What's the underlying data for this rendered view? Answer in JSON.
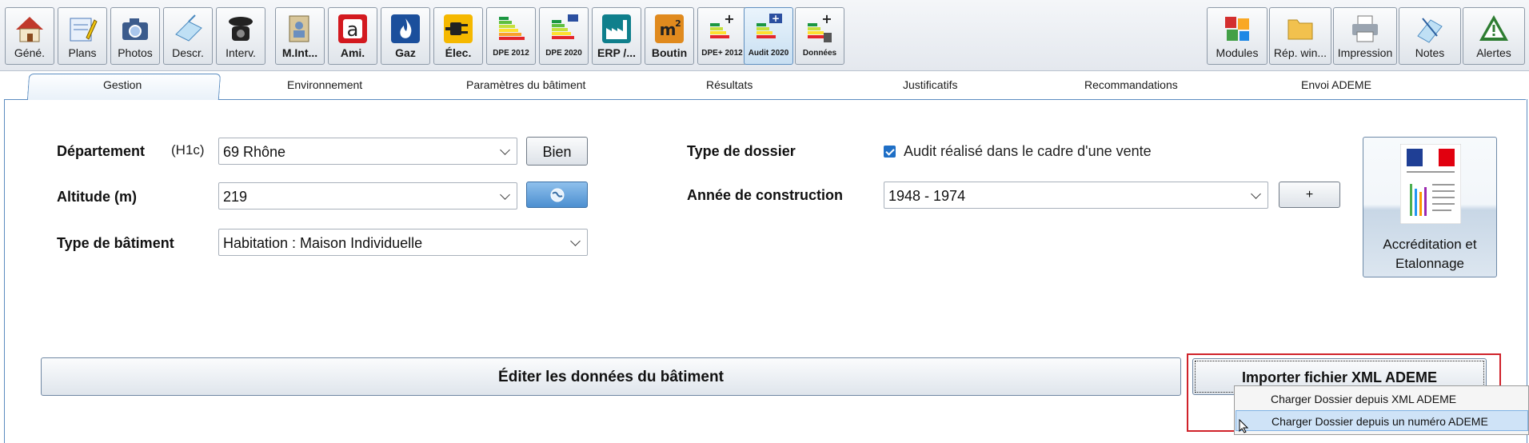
{
  "toolbar": {
    "left_buttons": [
      {
        "label": "Géné.",
        "icon": "house-icon"
      },
      {
        "label": "Plans",
        "icon": "plans-pencil-icon"
      },
      {
        "label": "Photos",
        "icon": "camera-icon"
      },
      {
        "label": "Descr.",
        "icon": "description-icon"
      },
      {
        "label": "Interv.",
        "icon": "phone-icon"
      },
      {
        "label": "M.Int...",
        "icon": "document-person-icon"
      },
      {
        "label": "Ami.",
        "icon": "asbestos-a-icon"
      },
      {
        "label": "Gaz",
        "icon": "gas-flame-icon"
      },
      {
        "label": "Élec.",
        "icon": "electric-plug-icon"
      },
      {
        "label": "DPE 2012",
        "icon": "energy-label-icon"
      },
      {
        "label": "DPE 2020",
        "icon": "energy-label-eu-icon"
      },
      {
        "label": "ERP /...",
        "icon": "factory-icon"
      },
      {
        "label": "Boutin",
        "icon": "m2-surface-icon"
      },
      {
        "label": "DPE+ 2012",
        "icon": "energy-label-plus-icon"
      },
      {
        "label": "Audit 2020",
        "icon": "energy-label-plus-active-icon"
      },
      {
        "label": "Données",
        "icon": "energy-label-data-icon"
      }
    ],
    "right_buttons": [
      {
        "label": "Modules",
        "icon": "puzzle-icon"
      },
      {
        "label": "Rép. win...",
        "icon": "folder-icon"
      },
      {
        "label": "Impression",
        "icon": "printer-icon"
      },
      {
        "label": "Notes",
        "icon": "notes-icon"
      },
      {
        "label": "Alertes",
        "icon": "alert-triangle-icon"
      }
    ]
  },
  "tabs": [
    "Gestion",
    "Environnement",
    "Paramètres du bâtiment",
    "Résultats",
    "Justificatifs",
    "Recommandations",
    "Envoi ADEME"
  ],
  "form": {
    "departement_label": "Département",
    "departement_zone": "(H1c)",
    "departement_value": "69  Rhône",
    "bien_button": "Bien",
    "altitude_label": "Altitude (m)",
    "altitude_value": "219",
    "type_batiment_label": "Type de bâtiment",
    "type_batiment_value": "Habitation : Maison Individuelle",
    "type_dossier_label": "Type de dossier",
    "type_dossier_checkbox": "Audit réalisé dans le cadre d'une vente",
    "annee_label": "Année de construction",
    "annee_value": "1948 - 1974",
    "plus_button": "+",
    "accreditation_line1": "Accréditation et",
    "accreditation_line2": "Etalonnage"
  },
  "actions": {
    "edit_button": "Éditer les données du bâtiment",
    "import_button": "Importer fichier XML ADEME"
  },
  "menu": {
    "items": [
      "Charger Dossier depuis XML ADEME",
      "Charger Dossier depuis un numéro ADEME"
    ]
  },
  "colors": {
    "accent": "#1f6fc6",
    "highlight": "#cfe3f7",
    "red_frame": "#d0222a"
  }
}
